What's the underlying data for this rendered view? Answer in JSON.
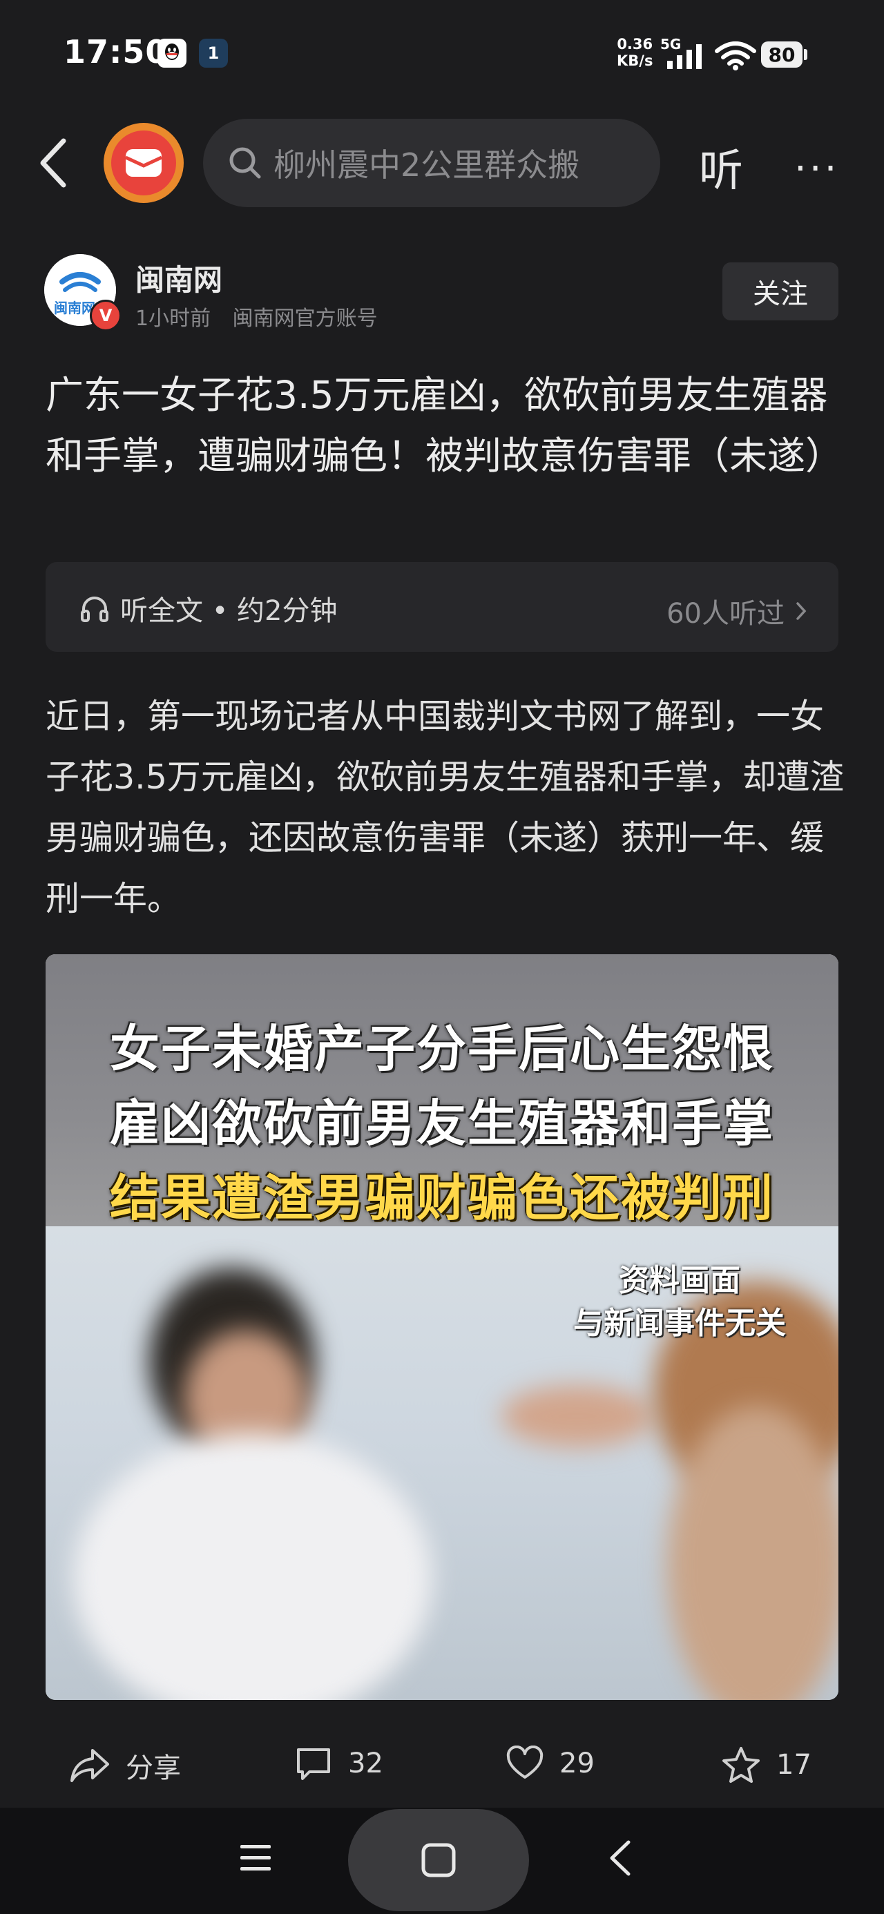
{
  "status_bar": {
    "time": "17:50",
    "net_speed_value": "0.36",
    "net_speed_unit": "KB/s",
    "network_type": "5G",
    "battery": "80"
  },
  "top_bar": {
    "search_placeholder": "柳州震中2公里群众搬",
    "listen_label": "听",
    "more_label": "···"
  },
  "author": {
    "name": "闽南网",
    "avatar_text": "闽南网",
    "time": "1小时前",
    "account_type": "闽南网官方账号",
    "verified_mark": "V",
    "follow_label": "关注"
  },
  "article": {
    "title": "广东一女子花3.5万元雇凶，欲砍前男友生殖器和手掌，遭骗财骗色！被判故意伤害罪（未遂）",
    "listen_all": "听全文 • 约2分钟",
    "listen_count": "60人听过",
    "body": "近日，第一现场记者从中国裁判文书网了解到，一女子花3.5万元雇凶，欲砍前男友生殖器和手掌，却遭渣男骗财骗色，还因故意伤害罪（未遂）获刑一年、缓刑一年。"
  },
  "news_image": {
    "headline_line1": "女子未婚产子分手后心生怨恨",
    "headline_line2": "雇凶欲砍前男友生殖器和手掌",
    "headline_line3": "结果遭渣男骗财骗色还被判刑",
    "note_line1": "资料画面",
    "note_line2": "与新闻事件无关"
  },
  "actions": {
    "share_label": "分享",
    "comment_count": "32",
    "like_count": "29",
    "favorite_count": "17"
  },
  "colors": {
    "background": "#1c1c1e",
    "accent_red": "#e8433c",
    "accent_orange": "#ea8a2c",
    "headline_yellow": "#ffd84a"
  }
}
